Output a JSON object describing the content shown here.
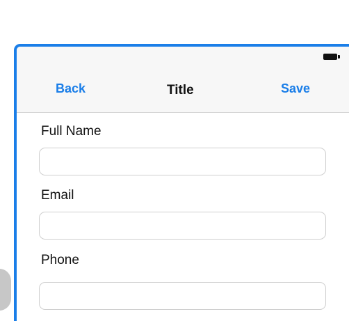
{
  "nav": {
    "back_label": "Back",
    "title": "Title",
    "save_label": "Save"
  },
  "status_bar": {
    "battery_icon": "battery-icon"
  },
  "form": {
    "fields": [
      {
        "label": "Full Name",
        "value": "",
        "placeholder": ""
      },
      {
        "label": "Email",
        "value": "",
        "placeholder": ""
      },
      {
        "label": "Phone",
        "value": "",
        "placeholder": ""
      }
    ]
  },
  "colors": {
    "accent": "#1a7ee8",
    "nav_background": "#f7f7f7",
    "text": "#111111"
  }
}
